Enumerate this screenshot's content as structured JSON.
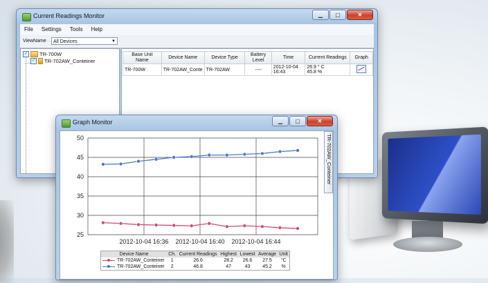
{
  "main_window": {
    "title": "Current Readings Monitor",
    "menu": [
      "File",
      "Settings",
      "Tools",
      "Help"
    ],
    "view_label": "ViewName",
    "view_value": "All Devices",
    "tree": {
      "root": "TR-700W",
      "child": "TR-702AW_Conteiner"
    },
    "table": {
      "headers": [
        "Base Unit Name",
        "Device Name",
        "Device Type",
        "Battery Level",
        "Time",
        "Current Readings",
        "Graph"
      ],
      "row": {
        "base_unit": "TR-700W",
        "device_name": "TR-702AW_Conte",
        "device_type": "TR-702AW",
        "battery": "----",
        "time_line1": "2012-10-04",
        "time_line2": "16:43",
        "reading1": "26.9 ° C",
        "reading2": "45.8 %"
      }
    }
  },
  "graph_window": {
    "title": "Graph Monitor",
    "side_tab": "TR-702AW_Conteiner",
    "legend": {
      "headers": [
        "Device Name",
        "Ch.",
        "Current Readings",
        "Highest",
        "Lowest",
        "Average",
        "Unit"
      ],
      "rows": [
        {
          "name": "TR-702AW_Conteiner",
          "ch": "1",
          "current": "26.6",
          "highest": "28.2",
          "lowest": "26.6",
          "average": "27.5",
          "unit": "°C"
        },
        {
          "name": "TR-702AW_Conteiner",
          "ch": "2",
          "current": "46.8",
          "highest": "47",
          "lowest": "43",
          "average": "45.2",
          "unit": "%"
        }
      ]
    }
  },
  "chart_data": {
    "type": "line",
    "x_ticks": [
      "2012-10-04 16:36",
      "2012-10-04 16:40",
      "2012-10-04 16:44"
    ],
    "y_ticks": [
      "25",
      "30",
      "35",
      "40",
      "45",
      "50"
    ],
    "ylim": [
      25,
      50
    ],
    "grid": true,
    "series": [
      {
        "color": "#4a78c8",
        "values": [
          43.2,
          43.3,
          44.0,
          44.5,
          45.0,
          45.2,
          45.6,
          45.6,
          45.8,
          46.0,
          46.5,
          46.8
        ]
      },
      {
        "color": "#d04a6a",
        "values": [
          28.1,
          27.9,
          27.6,
          27.5,
          27.4,
          27.3,
          27.9,
          27.1,
          27.3,
          27.1,
          26.8,
          26.6
        ]
      }
    ]
  }
}
